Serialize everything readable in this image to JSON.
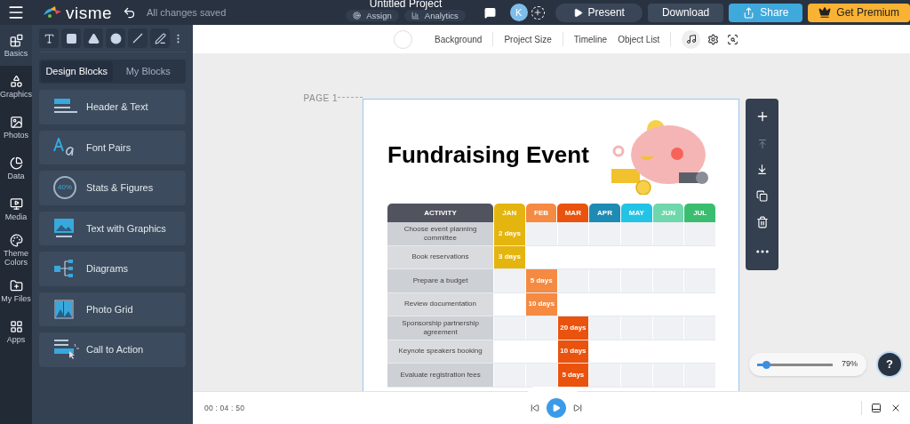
{
  "top_bar": {
    "logo": "visme",
    "save_status": "All changes saved",
    "project_title": "Untitled Project",
    "project_actions": [
      {
        "label": "Assign",
        "kind": "assign"
      },
      {
        "label": "Analytics",
        "kind": "analytics"
      }
    ],
    "avatar": "K",
    "buttons": [
      {
        "label": "Present",
        "kind": "present"
      },
      {
        "label": "Download",
        "kind": "download"
      },
      {
        "label": "Share",
        "kind": "share"
      },
      {
        "label": "Get Premium",
        "kind": "premium"
      }
    ]
  },
  "rail": [
    {
      "label": "Basics",
      "kind": "basics",
      "selected": true
    },
    {
      "label": "Graphics",
      "kind": "graphics",
      "selected": false
    },
    {
      "label": "Photos",
      "kind": "photos",
      "selected": false
    },
    {
      "label": "Data",
      "kind": "data",
      "selected": false
    },
    {
      "label": "Media",
      "kind": "media",
      "selected": false
    },
    {
      "label": "Theme Colors",
      "kind": "colors",
      "selected": false
    },
    {
      "label": "My Files",
      "kind": "files",
      "selected": false
    },
    {
      "label": "Apps",
      "kind": "apps",
      "selected": false
    }
  ],
  "panel": {
    "tabs": [
      {
        "label": "Design Blocks",
        "selected": true
      },
      {
        "label": "My Blocks",
        "selected": false
      }
    ],
    "blocks": [
      {
        "label": "Header & Text",
        "kind": "header"
      },
      {
        "label": "Font Pairs",
        "kind": "fonts"
      },
      {
        "label": "Stats & Figures",
        "kind": "stats",
        "icon_text": "40%"
      },
      {
        "label": "Text with Graphics",
        "kind": "graphics"
      },
      {
        "label": "Diagrams",
        "kind": "diagram"
      },
      {
        "label": "Photo Grid",
        "kind": "photo"
      },
      {
        "label": "Call to Action",
        "kind": "cta"
      }
    ]
  },
  "canvas_toolbar": {
    "items": [
      "Background",
      "Project Size",
      "Timeline",
      "Object List"
    ]
  },
  "page": {
    "label": "PAGE 1",
    "title": "Fundraising Event",
    "table": {
      "columns": [
        {
          "label": "ACTIVITY",
          "color": "#51545f"
        },
        {
          "label": "JAN",
          "color": "#e5b50f"
        },
        {
          "label": "FEB",
          "color": "#f58a42"
        },
        {
          "label": "MAR",
          "color": "#e9530e"
        },
        {
          "label": "APR",
          "color": "#1d8bb3"
        },
        {
          "label": "MAY",
          "color": "#23c3e6"
        },
        {
          "label": "JUN",
          "color": "#6fd7ab"
        },
        {
          "label": "JUL",
          "color": "#3bbd6f"
        }
      ],
      "rows": [
        {
          "cells": [
            {
              "kind": "activity",
              "text": "Choose event planning committee"
            },
            {
              "kind": "bar",
              "text": "2 days"
            },
            {
              "kind": "empty"
            },
            {
              "kind": "empty"
            },
            {
              "kind": "empty"
            },
            {
              "kind": "empty"
            },
            {
              "kind": "empty"
            },
            {
              "kind": "empty"
            }
          ]
        },
        {
          "cells": [
            {
              "kind": "activity",
              "text": "Book reservations"
            },
            {
              "kind": "bar",
              "text": "3 days"
            },
            {
              "kind": "empty"
            },
            {
              "kind": "empty"
            },
            {
              "kind": "empty"
            },
            {
              "kind": "empty"
            },
            {
              "kind": "empty"
            },
            {
              "kind": "empty"
            }
          ]
        },
        {
          "cells": [
            {
              "kind": "activity",
              "text": "Prepare a budget"
            },
            {
              "kind": "empty"
            },
            {
              "kind": "bar",
              "text": "5 days"
            },
            {
              "kind": "empty"
            },
            {
              "kind": "empty"
            },
            {
              "kind": "empty"
            },
            {
              "kind": "empty"
            },
            {
              "kind": "empty"
            }
          ]
        },
        {
          "cells": [
            {
              "kind": "activity",
              "text": "Review documentation"
            },
            {
              "kind": "empty"
            },
            {
              "kind": "bar",
              "text": "10 days"
            },
            {
              "kind": "empty"
            },
            {
              "kind": "empty"
            },
            {
              "kind": "empty"
            },
            {
              "kind": "empty"
            },
            {
              "kind": "empty"
            }
          ]
        },
        {
          "cells": [
            {
              "kind": "activity",
              "text": "Sponsorship partnership agreement"
            },
            {
              "kind": "empty"
            },
            {
              "kind": "empty"
            },
            {
              "kind": "bar",
              "text": "20 days"
            },
            {
              "kind": "empty"
            },
            {
              "kind": "empty"
            },
            {
              "kind": "empty"
            },
            {
              "kind": "empty"
            }
          ]
        },
        {
          "cells": [
            {
              "kind": "activity",
              "text": "Keynote speakers booking"
            },
            {
              "kind": "empty"
            },
            {
              "kind": "empty"
            },
            {
              "kind": "bar",
              "text": "10 days"
            },
            {
              "kind": "empty"
            },
            {
              "kind": "empty"
            },
            {
              "kind": "empty"
            },
            {
              "kind": "empty"
            }
          ]
        },
        {
          "cells": [
            {
              "kind": "activity",
              "text": "Evaluate registration fees"
            },
            {
              "kind": "empty"
            },
            {
              "kind": "empty"
            },
            {
              "kind": "bar",
              "text": "5 days"
            },
            {
              "kind": "empty"
            },
            {
              "kind": "empty"
            },
            {
              "kind": "empty"
            },
            {
              "kind": "empty"
            }
          ]
        }
      ]
    }
  },
  "zoom": {
    "level": 0.12,
    "reading": "79%"
  },
  "help": "?",
  "player": {
    "time": "00 : 04 : 50"
  }
}
